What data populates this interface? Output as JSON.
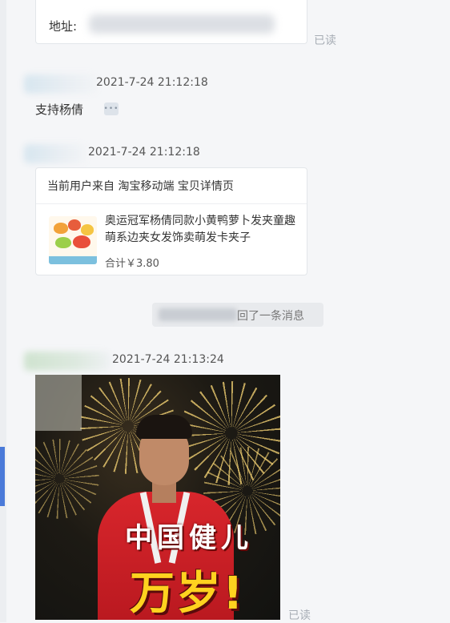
{
  "messages": {
    "address_card": {
      "label": "地址:",
      "read_status": "已读"
    },
    "message_1": {
      "timestamp": "2021-7-24 21:12:18",
      "text": "支持杨倩"
    },
    "message_2": {
      "timestamp": "2021-7-24 21:12:18",
      "card": {
        "source": "当前用户来自 淘宝移动端 宝贝详情页",
        "product_title": "奥运冠军杨倩同款小黄鸭萝卜发夹童趣萌系边夹女发饰卖萌发卡夹子",
        "price": "合计￥3.80"
      }
    },
    "system_notice": {
      "text": "回了一条消息"
    },
    "message_3": {
      "timestamp": "2021-7-24 21:13:24",
      "sticker": {
        "caption_line1": "中国健儿",
        "caption_line2": "万岁!"
      },
      "read_status": "已读"
    }
  },
  "icons": {
    "ellipsis": "ellipsis-icon",
    "product_thumbnail": "product-thumbnail"
  },
  "colors": {
    "background": "#f5f6f8",
    "card_border": "#e3e6ea",
    "read_status": "#a7adb5",
    "accent_rail": "#4a7ad9",
    "sticker_red": "#d8262c",
    "sticker_yellow": "#ffd21f"
  }
}
